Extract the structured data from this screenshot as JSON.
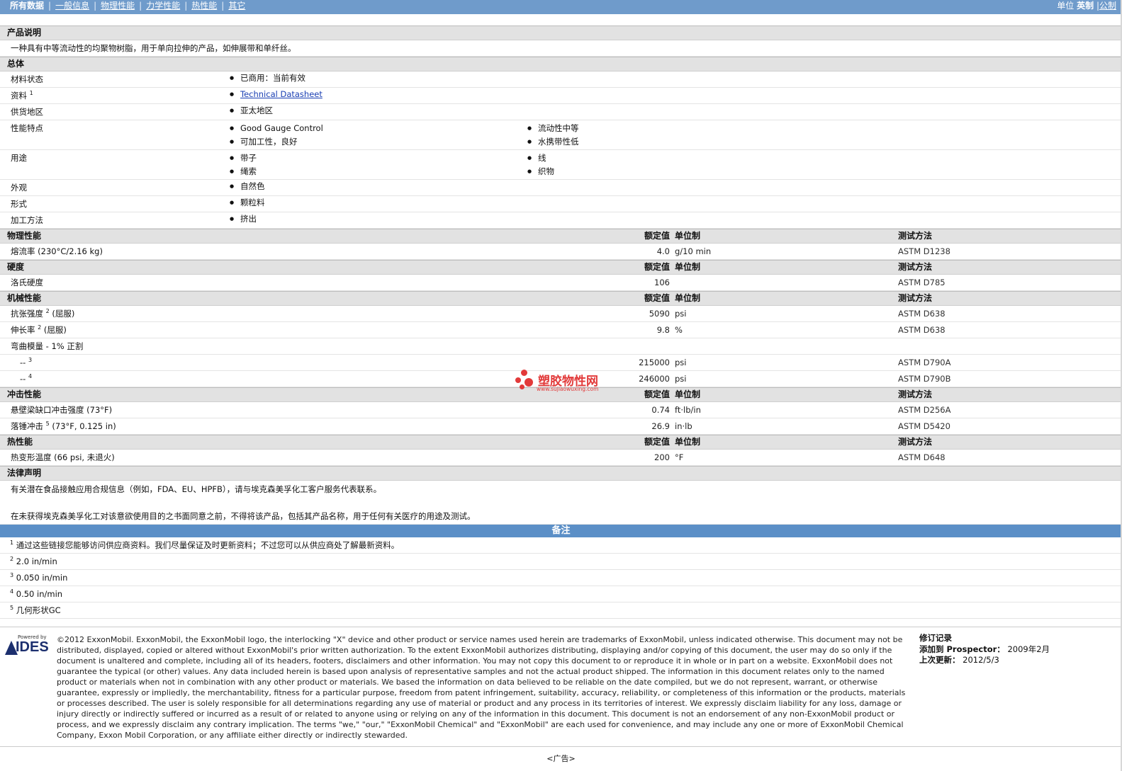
{
  "nav": {
    "items": [
      "所有数据",
      "一般信息",
      "物理性能",
      "力学性能",
      "热性能",
      "其它"
    ],
    "units_label": "单位",
    "unit_imperial": "英制",
    "unit_metric": "公制"
  },
  "description": {
    "title": "产品说明",
    "text": "一种具有中等流动性的均聚物树脂，用于单向拉伸的产品，如伸展带和单纤丝。"
  },
  "general": {
    "title": "总体",
    "rows": [
      {
        "label": "材料状态",
        "values": [
          "已商用：当前有效"
        ]
      },
      {
        "label": "资料",
        "sup": "1",
        "values": [
          "Technical Datasheet"
        ]
      },
      {
        "label": "供货地区",
        "values": [
          "亚太地区"
        ]
      },
      {
        "label": "性能特点",
        "values": [
          "Good Gauge Control",
          "流动性中等",
          "可加工性，良好",
          "水携带性低"
        ]
      },
      {
        "label": "用途",
        "values": [
          "带子",
          "线",
          "绳索",
          "织物"
        ]
      },
      {
        "label": "外观",
        "values": [
          "自然色"
        ]
      },
      {
        "label": "形式",
        "values": [
          "颗粒料"
        ]
      },
      {
        "label": "加工方法",
        "values": [
          "挤出"
        ]
      }
    ]
  },
  "headers": {
    "value": "额定值",
    "unit": "单位制",
    "method": "测试方法"
  },
  "physical": {
    "title": "物理性能",
    "rows": [
      {
        "label": "熔流率",
        "cond": "(230°C/2.16 kg)",
        "value": "4.0",
        "unit": "g/10 min",
        "method": "ASTM D1238"
      }
    ]
  },
  "hardness": {
    "title": "硬度",
    "rows": [
      {
        "label": "洛氏硬度",
        "value": "106",
        "unit": "",
        "method": "ASTM D785"
      }
    ]
  },
  "mechanical": {
    "title": "机械性能",
    "rows": [
      {
        "label": "抗张强度",
        "sup": "2",
        "cond": "(屈服)",
        "value": "5090",
        "unit": "psi",
        "method": "ASTM D638"
      },
      {
        "label": "伸长率",
        "sup": "2",
        "cond": "(屈服)",
        "value": "9.8",
        "unit": "%",
        "method": "ASTM D638"
      },
      {
        "label": "弯曲模量",
        "cond": "- 1% 正割"
      },
      {
        "label": "--",
        "sup": "3",
        "value": "215000",
        "unit": "psi",
        "method": "ASTM D790A"
      },
      {
        "label": "--",
        "sup": "4",
        "value": "246000",
        "unit": "psi",
        "method": "ASTM D790B"
      }
    ]
  },
  "impact": {
    "title": "冲击性能",
    "rows": [
      {
        "label": "悬壁梁缺口冲击强度",
        "cond": "(73°F)",
        "value": "0.74",
        "unit": "ft·lb/in",
        "method": "ASTM D256A"
      },
      {
        "label": "落锤冲击",
        "sup": "5",
        "cond": "(73°F, 0.125 in)",
        "value": "26.9",
        "unit": "in·lb",
        "method": "ASTM D5420"
      }
    ]
  },
  "thermal": {
    "title": "热性能",
    "rows": [
      {
        "label": "热变形温度",
        "cond": "(66 psi, 未退火)",
        "value": "200",
        "unit": "°F",
        "method": "ASTM D648"
      }
    ]
  },
  "legal": {
    "title": "法律声明",
    "p1": "有关潜在食品接触应用合规信息（例如，FDA、EU、HPFB），请与埃克森美孚化工客户服务代表联系。",
    "p2": "在未获得埃克森美孚化工对该意欲使用目的之书面同意之前，不得将该产品，包括其产品名称，用于任何有关医疗的用途及测试。"
  },
  "notes": {
    "title": "备注",
    "items": [
      {
        "n": "1",
        "text": "通过这些链接您能够访问供应商资料。我们尽量保证及时更新资料；不过您可以从供应商处了解最新资料。"
      },
      {
        "n": "2",
        "text": "2.0 in/min"
      },
      {
        "n": "3",
        "text": "0.050 in/min"
      },
      {
        "n": "4",
        "text": "0.50 in/min"
      },
      {
        "n": "5",
        "text": "几何形状GC"
      }
    ]
  },
  "watermark": {
    "name": "塑胶物性网",
    "url": "www.sujiaowuxing.com"
  },
  "footer": {
    "logo_powered": "Powered by",
    "logo_name": "IDES",
    "copyright": "©2012 ExxonMobil. ExxonMobil, the ExxonMobil logo, the interlocking \"X\" device and other product or service names used herein are trademarks of ExxonMobil, unless indicated otherwise. This document may not be distributed, displayed, copied or altered without ExxonMobil's prior written authorization. To the extent ExxonMobil authorizes distributing, displaying and/or copying of this document, the user may do so only if the document is unaltered and complete, including all of its headers, footers, disclaimers and other information. You may not copy this document to or reproduce it in whole or in part on a website. ExxonMobil does not guarantee the typical (or other) values. Any data included herein is based upon analysis of representative samples and not the actual product shipped. The information in this document relates only to the named product or materials when not in combination with any other product or materials. We based the information on data believed to be reliable on the date compiled, but we do not represent, warrant, or otherwise guarantee, expressly or impliedly, the merchantability, fitness for a particular purpose, freedom from patent infringement, suitability, accuracy, reliability, or completeness of this information or the products, materials or processes described. The user is solely responsible for all determinations regarding any use of material or product and any process in its territories of interest. We expressly disclaim liability for any loss, damage or injury directly or indirectly suffered or incurred as a result of or related to anyone using or relying on any of the information in this document. This document is not an endorsement of any non-ExxonMobil product or process, and we expressly disclaim any contrary implication. The terms \"we,\" \"our,\" \"ExxonMobil Chemical\" and \"ExxonMobil\" are each used for convenience, and may include any one or more of ExxonMobil Chemical Company, Exxon Mobil Corporation, or any affiliate either directly or indirectly stewarded.",
    "rev_title": "修订记录",
    "rev_added_label": "添加到 Prospector：",
    "rev_added_value": "2009年2月",
    "rev_updated_label": "上次更新：",
    "rev_updated_value": "2012/5/3",
    "ad": "<广告>"
  }
}
